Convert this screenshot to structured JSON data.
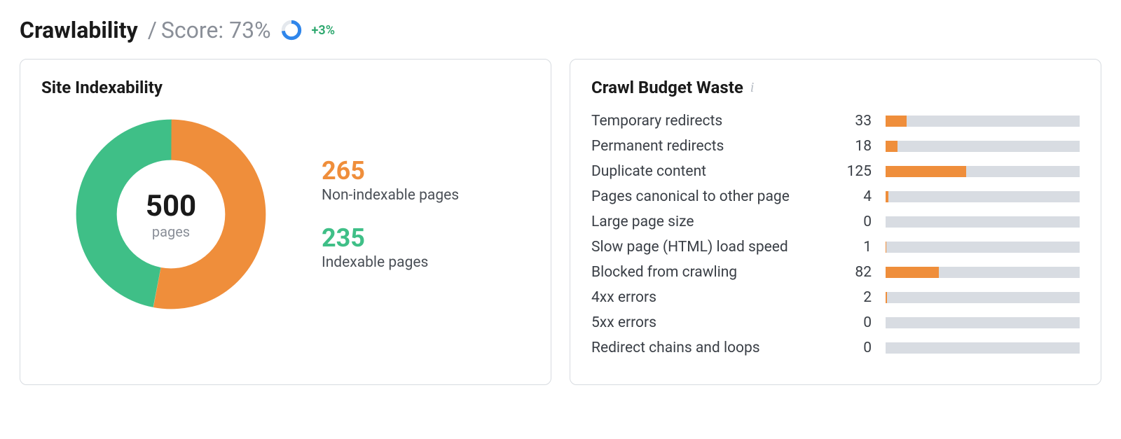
{
  "header": {
    "title": "Crawlability",
    "score_label": "Score: 73%",
    "delta": "+3%"
  },
  "indexability": {
    "title": "Site Indexability",
    "total": "500",
    "total_label": "pages",
    "non_indexable_value": "265",
    "non_indexable_label": "Non-indexable pages",
    "indexable_value": "235",
    "indexable_label": "Indexable pages"
  },
  "budget": {
    "title": "Crawl Budget Waste",
    "items": [
      {
        "label": "Temporary redirects",
        "value": "33"
      },
      {
        "label": "Permanent redirects",
        "value": "18"
      },
      {
        "label": "Duplicate content",
        "value": "125"
      },
      {
        "label": "Pages canonical to other page",
        "value": "4"
      },
      {
        "label": "Large page size",
        "value": "0"
      },
      {
        "label": "Slow page (HTML) load speed",
        "value": "1"
      },
      {
        "label": "Blocked from crawling",
        "value": "82"
      },
      {
        "label": "4xx errors",
        "value": "2"
      },
      {
        "label": "5xx errors",
        "value": "0"
      },
      {
        "label": "Redirect chains and loops",
        "value": "0"
      }
    ]
  },
  "chart_data": [
    {
      "type": "pie",
      "title": "Site Indexability",
      "total": 500,
      "series": [
        {
          "name": "Non-indexable pages",
          "value": 265,
          "color": "#ef8e3b"
        },
        {
          "name": "Indexable pages",
          "value": 235,
          "color": "#3fbf87"
        }
      ]
    },
    {
      "type": "bar",
      "title": "Crawl Budget Waste",
      "categories": [
        "Temporary redirects",
        "Permanent redirects",
        "Duplicate content",
        "Pages canonical to other page",
        "Large page size",
        "Slow page (HTML) load speed",
        "Blocked from crawling",
        "4xx errors",
        "5xx errors",
        "Redirect chains and loops"
      ],
      "values": [
        33,
        18,
        125,
        4,
        0,
        1,
        82,
        2,
        0,
        0
      ],
      "xlim": [
        0,
        300
      ]
    },
    {
      "type": "pie",
      "title": "Score ring",
      "series": [
        {
          "name": "Score",
          "value": 73,
          "color": "#2f86eb"
        },
        {
          "name": "Remaining",
          "value": 27,
          "color": "#e4e8ed"
        }
      ]
    }
  ]
}
